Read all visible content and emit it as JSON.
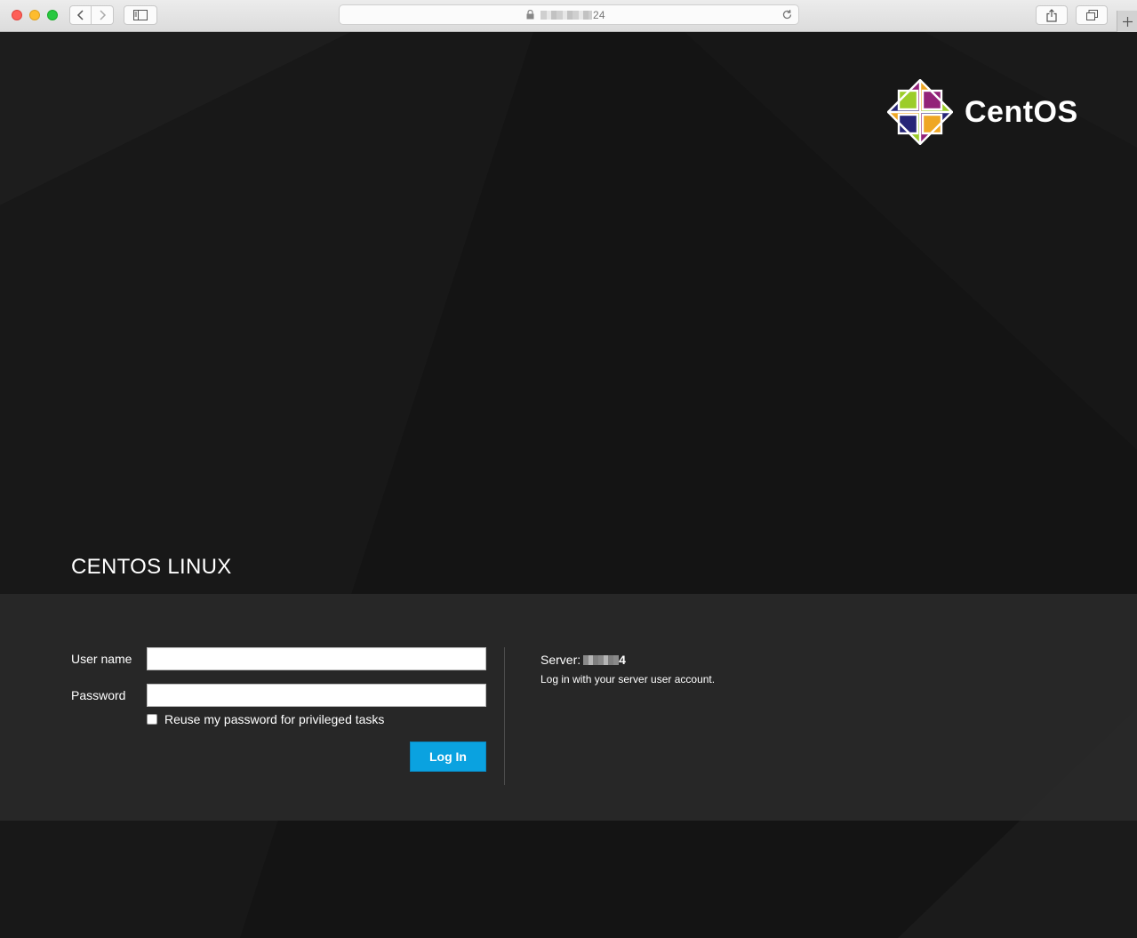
{
  "browser": {
    "url_visible_suffix": "24",
    "buttons": {
      "back": "back",
      "forward": "forward",
      "sidebar": "sidebar",
      "share": "share",
      "tabs": "tabs",
      "new_tab": "new-tab"
    }
  },
  "logo": {
    "text": "CentOS"
  },
  "brand": {
    "title": "CENTOS LINUX"
  },
  "login": {
    "username_label": "User name",
    "username_value": "",
    "password_label": "Password",
    "password_value": "",
    "reuse_password_label": "Reuse my password for privileged tasks",
    "reuse_password_checked": false,
    "submit_label": "Log In"
  },
  "server": {
    "label": "Server:",
    "host_visible_suffix": "4",
    "hint": "Log in with your server user account."
  },
  "colors": {
    "accent": "#0aa2e0",
    "page_background": "#141414",
    "band_background": "#292929",
    "logo_green": "#9ccd2a",
    "logo_purple": "#932279",
    "logo_blue": "#262577",
    "logo_orange": "#efa724"
  },
  "icons": [
    "lock-icon",
    "reload-icon",
    "share-icon",
    "tabs-icon",
    "plus-icon",
    "sidebar-icon",
    "chevron-left-icon",
    "chevron-right-icon"
  ]
}
